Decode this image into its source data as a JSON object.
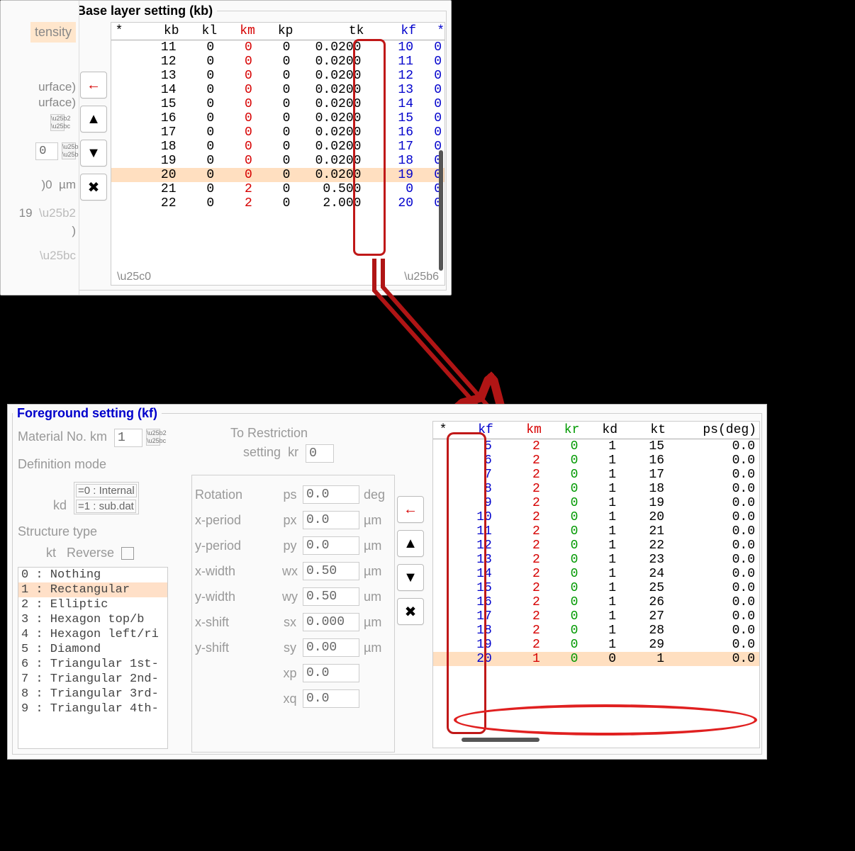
{
  "topPanel": {
    "title": "Base layer setting (kb)",
    "leftSliver": {
      "tensity": "tensity",
      "surface1": "urface)",
      "surface2": "urface)",
      "spinVal": "0",
      "micronLabel": "µm",
      "micronNum": ")0",
      "num19": "19",
      "paren": ")"
    },
    "navButtons": {
      "back": "←",
      "up": "▲",
      "down": "▼",
      "close": "✖"
    },
    "headers": {
      "star": "*",
      "kb": "kb",
      "kl": "kl",
      "km": "km",
      "kp": "kp",
      "tk": "tk",
      "kf": "kf",
      "star2": "*"
    },
    "rows": [
      {
        "kb": "11",
        "kl": "0",
        "km": "0",
        "kp": "0",
        "tk": "0.0200",
        "kf": "10",
        "s": "0"
      },
      {
        "kb": "12",
        "kl": "0",
        "km": "0",
        "kp": "0",
        "tk": "0.0200",
        "kf": "11",
        "s": "0"
      },
      {
        "kb": "13",
        "kl": "0",
        "km": "0",
        "kp": "0",
        "tk": "0.0200",
        "kf": "12",
        "s": "0"
      },
      {
        "kb": "14",
        "kl": "0",
        "km": "0",
        "kp": "0",
        "tk": "0.0200",
        "kf": "13",
        "s": "0"
      },
      {
        "kb": "15",
        "kl": "0",
        "km": "0",
        "kp": "0",
        "tk": "0.0200",
        "kf": "14",
        "s": "0"
      },
      {
        "kb": "16",
        "kl": "0",
        "km": "0",
        "kp": "0",
        "tk": "0.0200",
        "kf": "15",
        "s": "0"
      },
      {
        "kb": "17",
        "kl": "0",
        "km": "0",
        "kp": "0",
        "tk": "0.0200",
        "kf": "16",
        "s": "0"
      },
      {
        "kb": "18",
        "kl": "0",
        "km": "0",
        "kp": "0",
        "tk": "0.0200",
        "kf": "17",
        "s": "0"
      },
      {
        "kb": "19",
        "kl": "0",
        "km": "0",
        "kp": "0",
        "tk": "0.0200",
        "kf": "18",
        "s": "0"
      },
      {
        "kb": "20",
        "kl": "0",
        "km": "0",
        "kp": "0",
        "tk": "0.0200",
        "kf": "19",
        "s": "0",
        "hl": true
      },
      {
        "kb": "21",
        "kl": "0",
        "km": "2",
        "kp": "0",
        "tk": "0.500",
        "kf": "0",
        "s": "0"
      },
      {
        "kb": "22",
        "kl": "0",
        "km": "2",
        "kp": "0",
        "tk": "2.000",
        "kf": "20",
        "s": "0"
      }
    ]
  },
  "bottomPanel": {
    "title": "Foreground setting (kf)",
    "materialLabel": "Material No. km",
    "materialVal": "1",
    "restrictionLabel": "To Restriction",
    "restrictionSub": "setting",
    "krSym": "kr",
    "krVal": "0",
    "defModeLabel": "Definition mode",
    "kdSym": "kd",
    "kdOpt0": "=0 : Internal",
    "kdOpt1": "=1 : sub.dat",
    "structLabel": "Structure type",
    "ktSym": "kt",
    "reverseLabel": "Reverse",
    "listItems": [
      "0 : Nothing",
      "1 : Rectangular",
      "2 : Elliptic",
      "3 : Hexagon top/b",
      "4 : Hexagon left/ri",
      "5 : Diamond",
      "6 : Triangular 1st-",
      "7 : Triangular 2nd-",
      "8 : Triangular 3rd-",
      "9 : Triangular 4th-"
    ],
    "listSelectedIndex": 1,
    "params": [
      {
        "name": "Rotation",
        "sym": "ps",
        "val": "0.0",
        "unit": "deg"
      },
      {
        "name": "x-period",
        "sym": "px",
        "val": "0.0",
        "unit": "µm"
      },
      {
        "name": "y-period",
        "sym": "py",
        "val": "0.0",
        "unit": "µm"
      },
      {
        "name": "x-width",
        "sym": "wx",
        "val": "0.50",
        "unit": "µm"
      },
      {
        "name": "y-width",
        "sym": "wy",
        "val": "0.50",
        "unit": "um"
      },
      {
        "name": "x-shift",
        "sym": "sx",
        "val": "0.000",
        "unit": "µm"
      },
      {
        "name": "y-shift",
        "sym": "sy",
        "val": "0.00",
        "unit": "µm"
      },
      {
        "name": "",
        "sym": "xp",
        "val": "0.0",
        "unit": ""
      },
      {
        "name": "",
        "sym": "xq",
        "val": "0.0",
        "unit": ""
      }
    ],
    "navButtons": {
      "back": "←",
      "up": "▲",
      "down": "▼",
      "close": "✖"
    },
    "headers": {
      "star": "*",
      "kf": "kf",
      "km": "km",
      "kr": "kr",
      "kd": "kd",
      "kt": "kt",
      "ps": "ps(deg)"
    },
    "rows": [
      {
        "kf": "5",
        "km": "2",
        "kr": "0",
        "kd": "1",
        "kt": "15",
        "ps": "0.0"
      },
      {
        "kf": "6",
        "km": "2",
        "kr": "0",
        "kd": "1",
        "kt": "16",
        "ps": "0.0"
      },
      {
        "kf": "7",
        "km": "2",
        "kr": "0",
        "kd": "1",
        "kt": "17",
        "ps": "0.0"
      },
      {
        "kf": "8",
        "km": "2",
        "kr": "0",
        "kd": "1",
        "kt": "18",
        "ps": "0.0"
      },
      {
        "kf": "9",
        "km": "2",
        "kr": "0",
        "kd": "1",
        "kt": "19",
        "ps": "0.0"
      },
      {
        "kf": "10",
        "km": "2",
        "kr": "0",
        "kd": "1",
        "kt": "20",
        "ps": "0.0"
      },
      {
        "kf": "11",
        "km": "2",
        "kr": "0",
        "kd": "1",
        "kt": "21",
        "ps": "0.0"
      },
      {
        "kf": "12",
        "km": "2",
        "kr": "0",
        "kd": "1",
        "kt": "22",
        "ps": "0.0"
      },
      {
        "kf": "13",
        "km": "2",
        "kr": "0",
        "kd": "1",
        "kt": "23",
        "ps": "0.0"
      },
      {
        "kf": "14",
        "km": "2",
        "kr": "0",
        "kd": "1",
        "kt": "24",
        "ps": "0.0"
      },
      {
        "kf": "15",
        "km": "2",
        "kr": "0",
        "kd": "1",
        "kt": "25",
        "ps": "0.0"
      },
      {
        "kf": "16",
        "km": "2",
        "kr": "0",
        "kd": "1",
        "kt": "26",
        "ps": "0.0"
      },
      {
        "kf": "17",
        "km": "2",
        "kr": "0",
        "kd": "1",
        "kt": "27",
        "ps": "0.0"
      },
      {
        "kf": "18",
        "km": "2",
        "kr": "0",
        "kd": "1",
        "kt": "28",
        "ps": "0.0"
      },
      {
        "kf": "19",
        "km": "2",
        "kr": "0",
        "kd": "1",
        "kt": "29",
        "ps": "0.0"
      },
      {
        "kf": "20",
        "km": "1",
        "kr": "0",
        "kd": "0",
        "kt": "1",
        "ps": "0.0",
        "hl": true
      }
    ]
  }
}
